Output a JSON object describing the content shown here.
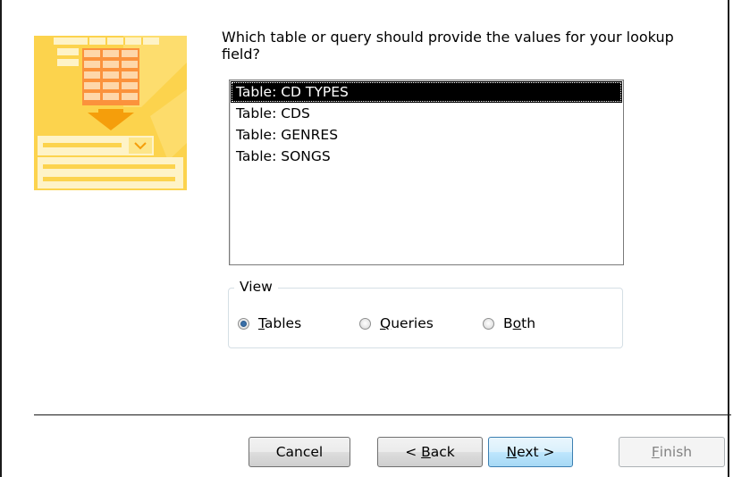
{
  "prompt": "Which table or query should provide the values for your lookup field?",
  "list": {
    "items": [
      {
        "label": "Table: CD TYPES",
        "selected": true
      },
      {
        "label": "Table: CDS",
        "selected": false
      },
      {
        "label": "Table: GENRES",
        "selected": false
      },
      {
        "label": "Table: SONGS",
        "selected": false
      }
    ]
  },
  "view": {
    "legend": "View",
    "options": [
      {
        "label": "Tables",
        "mnemonic": "T",
        "rest": "ables",
        "checked": true
      },
      {
        "label": "Queries",
        "mnemonic": "Q",
        "rest": "ueries",
        "checked": false
      },
      {
        "label": "Both",
        "prefix": "B",
        "mnemonic": "o",
        "rest": "th",
        "checked": false
      }
    ]
  },
  "buttons": {
    "cancel": "Cancel",
    "back_prefix": "< ",
    "back_mnemonic": "B",
    "back_rest": "ack",
    "next_mnemonic": "N",
    "next_rest": "ext >",
    "finish_mnemonic": "F",
    "finish_rest": "inish"
  },
  "colors": {
    "illustration_yellow": "#fcd44a",
    "illustration_orange": "#f5a623",
    "selection": "#000000",
    "default_button_border": "#3c7fb1"
  },
  "icons": {
    "illustration": "lookup-wizard-illustration"
  }
}
